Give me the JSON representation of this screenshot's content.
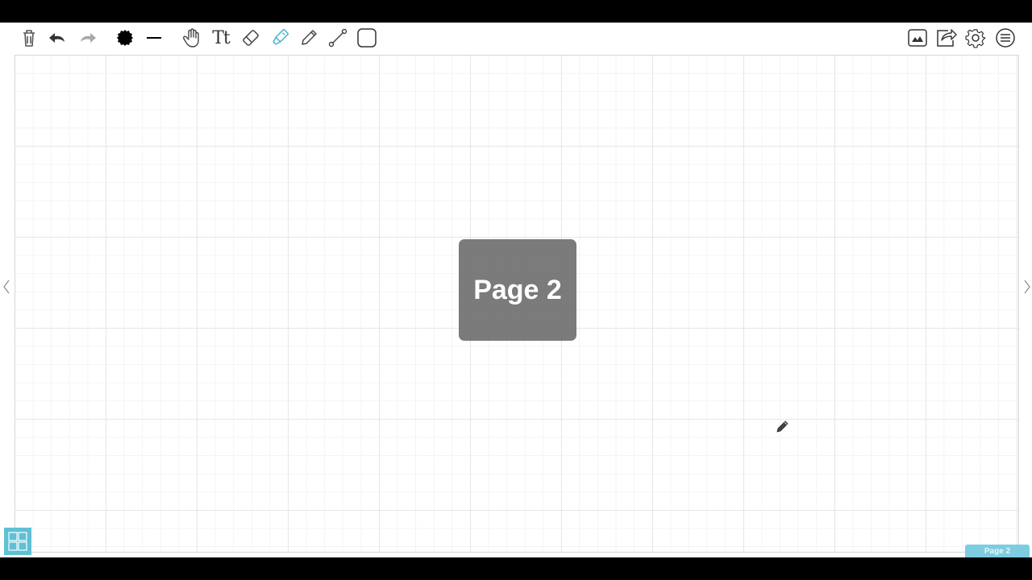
{
  "toolbar": {
    "left_tools": [
      {
        "name": "trash-icon"
      },
      {
        "name": "undo-icon"
      },
      {
        "name": "redo-icon"
      },
      {
        "name": "color-swatch-icon",
        "color": "#000000"
      },
      {
        "name": "stroke-width-icon"
      },
      {
        "name": "hand-tool-icon"
      },
      {
        "name": "text-tool",
        "label": "Tt"
      },
      {
        "name": "eraser-icon"
      },
      {
        "name": "highlighter-icon",
        "selected": true,
        "accent": "#4fb8cf"
      },
      {
        "name": "pencil-icon"
      },
      {
        "name": "line-tool-icon"
      },
      {
        "name": "shape-tool-icon"
      }
    ],
    "right_tools": [
      {
        "name": "insert-image-icon"
      },
      {
        "name": "share-icon"
      },
      {
        "name": "settings-gear-icon"
      },
      {
        "name": "menu-icon"
      }
    ]
  },
  "canvas": {
    "page_overlay_label": "Page 2",
    "page_tab_label": "Page 2"
  },
  "navigation": {
    "prev_icon": "chevron-left-icon",
    "next_icon": "chevron-right-icon",
    "pages_icon": "page-grid-icon"
  },
  "colors": {
    "accent": "#5fc0d6",
    "ink": "#000000"
  }
}
